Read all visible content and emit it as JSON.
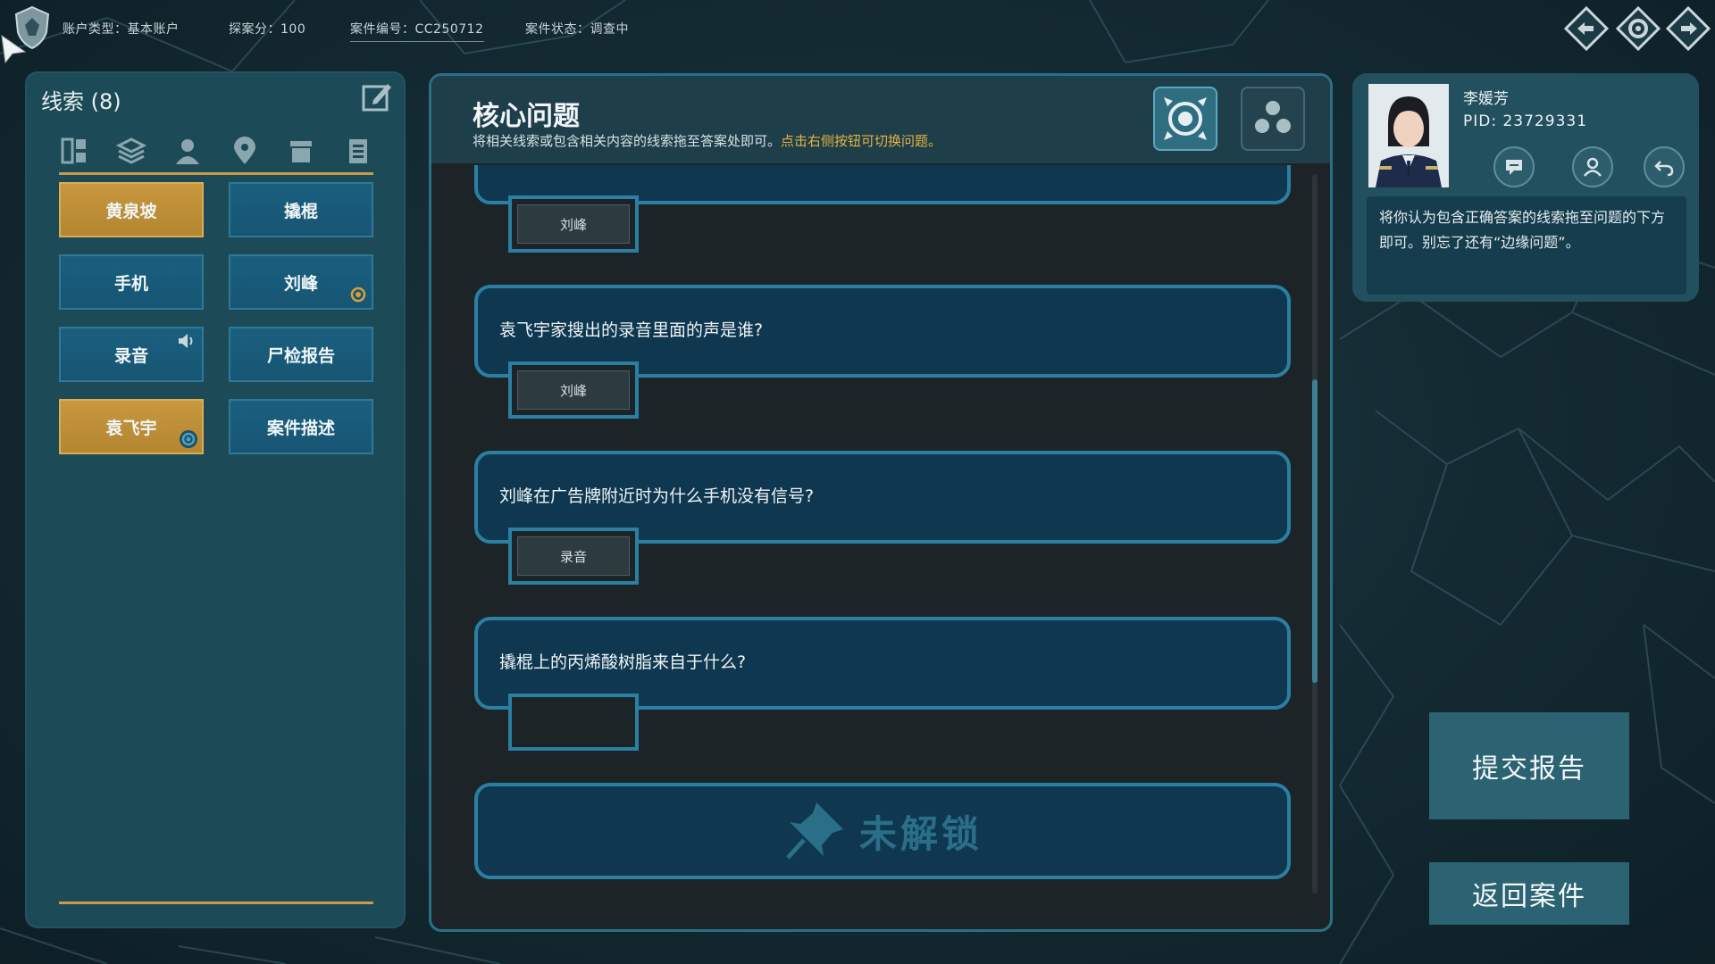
{
  "topbar": {
    "account_type": "账户类型：基本账户",
    "score": "探案分：100",
    "case_no": "案件编号：CC250712",
    "case_status": "案件状态：调查中",
    "icons": [
      "back-icon",
      "settings-icon",
      "exit-icon"
    ]
  },
  "clues": {
    "title": "线索 (8)",
    "categories": [
      "overview-icon",
      "layers-icon",
      "person-icon",
      "location-icon",
      "item-icon",
      "document-icon"
    ],
    "items": [
      {
        "label": "黄泉坡",
        "style": "gold"
      },
      {
        "label": "撬棍",
        "style": "blue"
      },
      {
        "label": "手机",
        "style": "blue"
      },
      {
        "label": "刘峰",
        "style": "blue",
        "badge": "orange"
      },
      {
        "label": "录音",
        "style": "blue",
        "sound": true
      },
      {
        "label": "尸检报告",
        "style": "blue"
      },
      {
        "label": "袁飞宇",
        "style": "gold",
        "badge": "blue"
      },
      {
        "label": "案件描述",
        "style": "blue"
      }
    ]
  },
  "core": {
    "title": "核心问题",
    "subtitle": "将相关线索或包含相关内容的线索拖至答案处即可。",
    "subtitle_highlight": "点击右侧按钮可切换问题。",
    "partial_answer": "刘峰",
    "questions": [
      {
        "text": "袁飞宇家搜出的录音里面的声是谁?",
        "answer": "刘峰"
      },
      {
        "text": "刘峰在广告牌附近时为什么手机没有信号?",
        "answer": "录音"
      },
      {
        "text": "撬棍上的丙烯酸树脂来自于什么?",
        "answer": ""
      }
    ],
    "locked_label": "未解锁"
  },
  "profile": {
    "name": "李媛芳",
    "pid": "PID: 23729331",
    "message": "将你认为包含正确答案的线索拖至问题的下方即可。别忘了还有“边缘问题”。"
  },
  "actions": {
    "submit": "提交报告",
    "back": "返回案件"
  },
  "colors": {
    "gold": "#c8983e",
    "blue": "#1a5f7e",
    "highlight": "#e3b442",
    "panel": "#1d4a57"
  }
}
